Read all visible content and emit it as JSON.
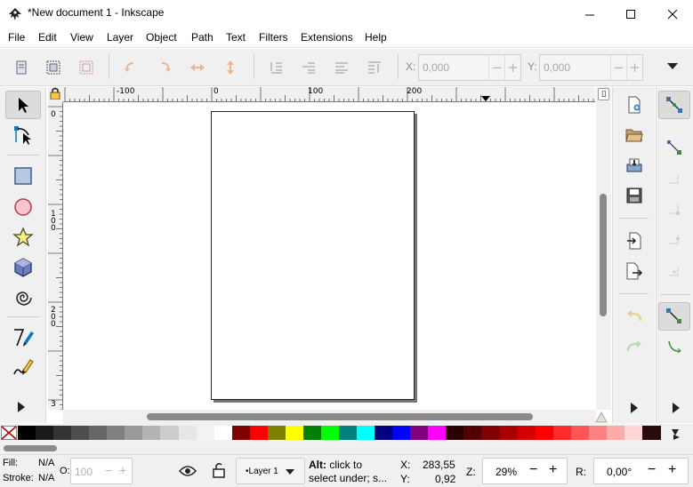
{
  "window": {
    "title": "*New document 1 - Inkscape",
    "minimize": "—",
    "maximize": "☐",
    "close": "✕"
  },
  "menu": [
    "File",
    "Edit",
    "View",
    "Layer",
    "Object",
    "Path",
    "Text",
    "Filters",
    "Extensions",
    "Help"
  ],
  "toolbar": {
    "x_label": "X:",
    "x_value": "0,000",
    "y_label": "Y:",
    "y_value": "0,000",
    "minus": "−",
    "plus": "+",
    "more": "▾"
  },
  "rulers": {
    "h_labels": [
      "-100",
      "0",
      "100",
      "200"
    ],
    "v_labels": [
      "0",
      "1\n0\n0",
      "2\n0\n0",
      "3"
    ]
  },
  "tools": [
    "selector-tool",
    "node-tool",
    "rectangle-tool",
    "ellipse-tool",
    "star-tool",
    "3d-box-tool",
    "spiral-tool",
    "pen-tool",
    "calligraphy-tool"
  ],
  "palette": {
    "colors": [
      "#000000",
      "#1a1a1a",
      "#333333",
      "#4d4d4d",
      "#666666",
      "#808080",
      "#999999",
      "#b3b3b3",
      "#cccccc",
      "#e6e6e6",
      "#f2f2f2",
      "#ffffff",
      "#800000",
      "#ff0000",
      "#808000",
      "#ffff00",
      "#008000",
      "#00ff00",
      "#008080",
      "#00ffff",
      "#000080",
      "#0000ff",
      "#800080",
      "#ff00ff",
      "#2b0000",
      "#550000",
      "#800000",
      "#aa0000",
      "#d40000",
      "#ff0000",
      "#ff2a2a",
      "#ff5555",
      "#ff8080",
      "#ffaaaa",
      "#ffd5d5",
      "#280b0b"
    ]
  },
  "status": {
    "fill_label": "Fill:",
    "fill_value": "N/A",
    "stroke_label": "Stroke:",
    "stroke_value": "N/A",
    "opacity_label": "O:",
    "opacity_value": "100",
    "layer": "•Layer 1",
    "message_bold": "Alt:",
    "message_line1": " click to",
    "message_line2": "select under; s...",
    "x_label": "X:",
    "x_value": "283,55",
    "y_label": "Y:",
    "y_value": "0,92",
    "zoom_label": "Z:",
    "zoom_value": "29%",
    "rotate_label": "R:",
    "rotate_value": "0,00°",
    "minus": "−",
    "plus": "+"
  }
}
